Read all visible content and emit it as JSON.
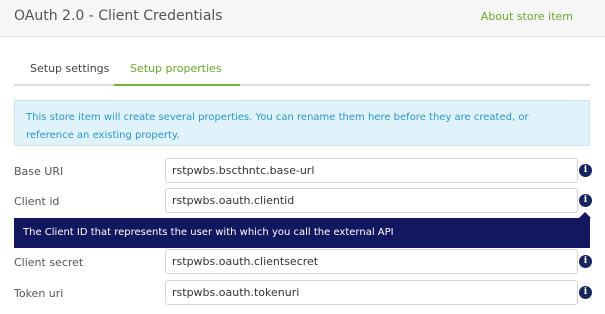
{
  "header": {
    "title": "OAuth 2.0 - Client Credentials",
    "about_link": "About store item"
  },
  "tabs": [
    {
      "label": "Setup settings",
      "active": false
    },
    {
      "label": "Setup properties",
      "active": true
    }
  ],
  "info": {
    "text": "This store item will create several properties. You can rename them here before they are created, or reference an existing property."
  },
  "fields": {
    "base_uri": {
      "label": "Base URI",
      "value": "rstpwbs.bscthntc.base-url"
    },
    "client_id": {
      "label": "Client id",
      "value": "rstpwbs.oauth.clientid"
    },
    "client_secret": {
      "label": "Client secret",
      "value": "rstpwbs.oauth.clientsecret"
    },
    "token_uri": {
      "label": "Token uri",
      "value": "rstpwbs.oauth.tokenuri"
    }
  },
  "tooltip": {
    "text": "The Client ID that represents the user with which you call the external API"
  },
  "icons": {
    "info_glyph": "i"
  },
  "colors": {
    "accent_green": "#6aa82c",
    "info_blue_text": "#2a96c7",
    "info_blue_bg": "#e0f3fb",
    "tooltip_navy": "#13175f"
  }
}
